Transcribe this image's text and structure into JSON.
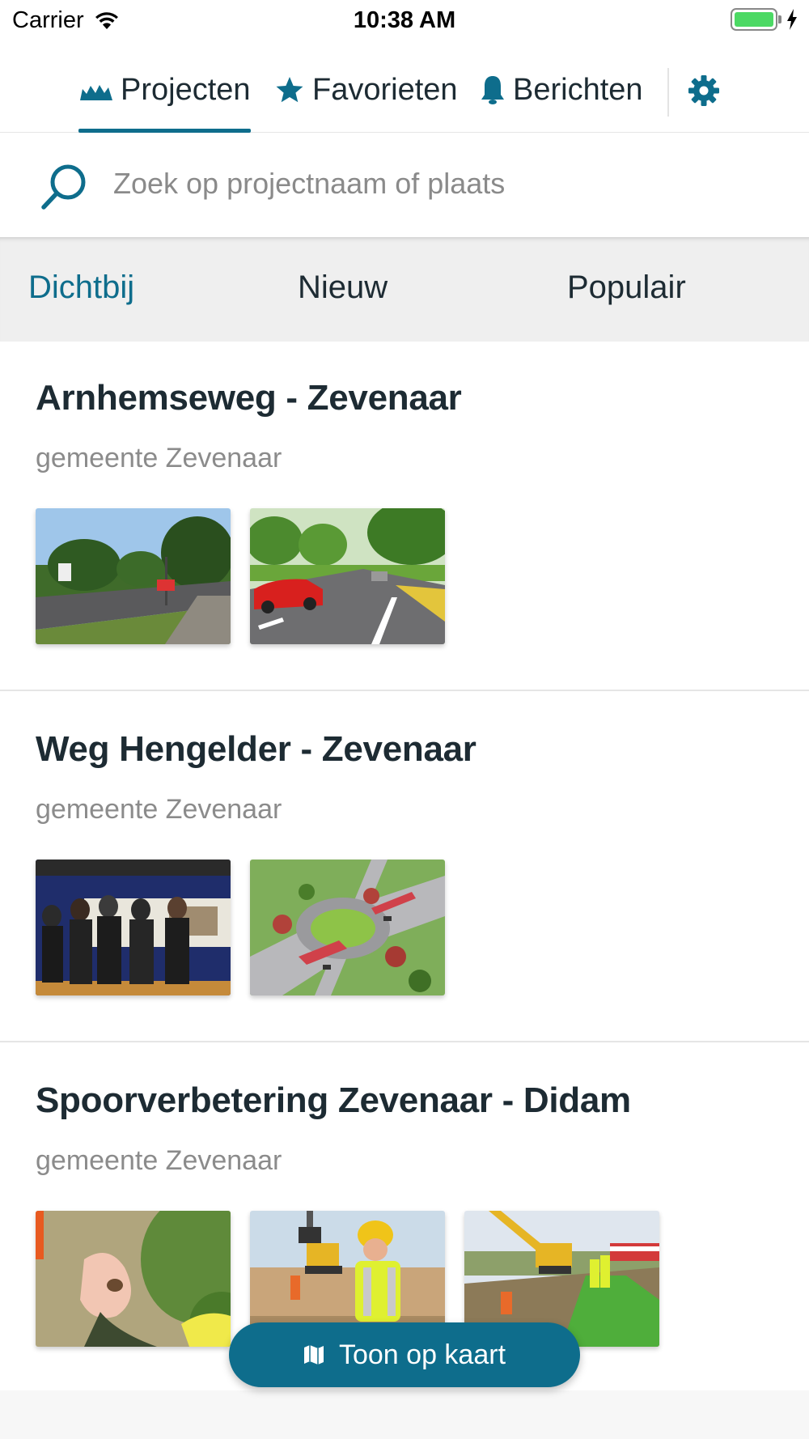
{
  "status_bar": {
    "carrier": "Carrier",
    "time": "10:38 AM"
  },
  "top_nav": {
    "tabs": [
      {
        "label": "Projecten",
        "icon": "crane-icon",
        "active": true
      },
      {
        "label": "Favorieten",
        "icon": "star-icon",
        "active": false
      },
      {
        "label": "Berichten",
        "icon": "bell-icon",
        "active": false
      }
    ],
    "settings_icon": "gear-icon"
  },
  "search": {
    "placeholder": "Zoek op projectnaam of plaats",
    "value": ""
  },
  "filters": {
    "tabs": [
      "Dichtbij",
      "Nieuw",
      "Populair"
    ],
    "active": "Dichtbij"
  },
  "projects": [
    {
      "title": "Arnhemseweg - Zevenaar",
      "subtitle": "gemeente Zevenaar",
      "image_count": 2
    },
    {
      "title": "Weg Hengelder - Zevenaar",
      "subtitle": "gemeente Zevenaar",
      "image_count": 2
    },
    {
      "title": "Spoorverbetering Zevenaar - Didam",
      "subtitle": "gemeente Zevenaar",
      "image_count": 3
    }
  ],
  "map_button": {
    "label": "Toon op kaart",
    "icon": "map-icon"
  },
  "colors": {
    "accent": "#0e6d8c",
    "text": "#1d2b33",
    "muted": "#8b8b8b",
    "filter_bg": "#efefef"
  }
}
